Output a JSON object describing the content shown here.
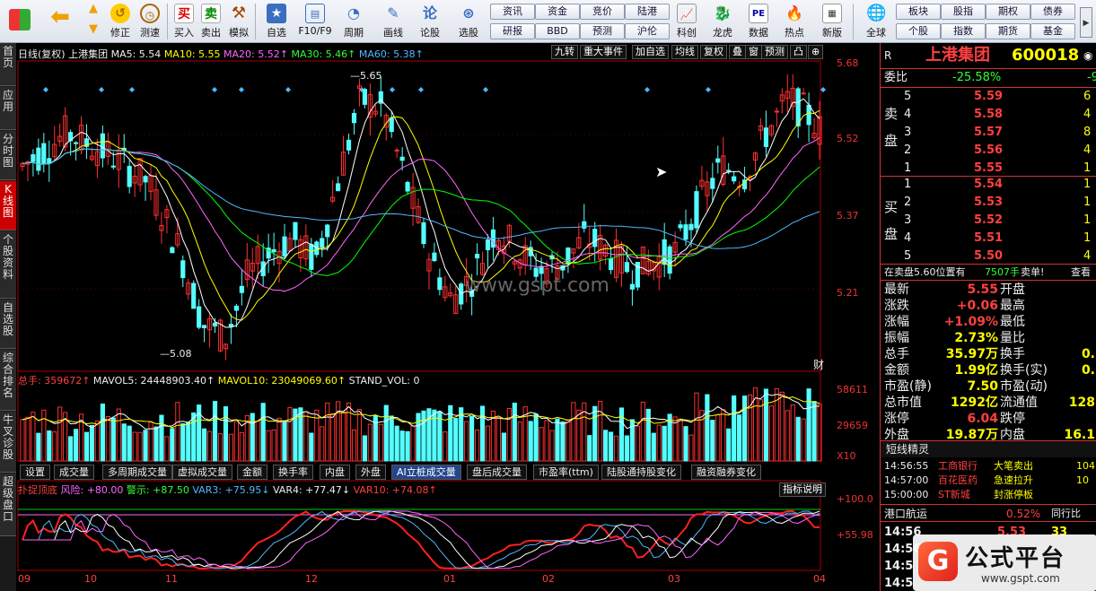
{
  "toolbar": {
    "big": [
      {
        "label": "",
        "icon": "windows-icon"
      },
      {
        "label": "",
        "icon": "back-arrow-icon"
      },
      {
        "label": "修正",
        "icon": "fix-icon"
      },
      {
        "label": "测速",
        "icon": "clock-icon"
      },
      {
        "label": "买入",
        "icon": "buy-icon",
        "glyph": "买"
      },
      {
        "label": "卖出",
        "icon": "sell-icon",
        "glyph": "卖"
      },
      {
        "label": "模拟",
        "icon": "hammer-icon"
      },
      {
        "label": "自选",
        "icon": "star-icon"
      },
      {
        "label": "F10/F9",
        "icon": "f10-icon"
      },
      {
        "label": "周期",
        "icon": "period-icon"
      },
      {
        "label": "画线",
        "icon": "pencil-icon"
      },
      {
        "label": "论股",
        "icon": "forum-icon",
        "glyph": "论"
      },
      {
        "label": "选股",
        "icon": "select-icon"
      },
      {
        "label": "科创",
        "icon": "kechuang-icon"
      },
      {
        "label": "龙虎",
        "icon": "dragon-icon"
      },
      {
        "label": "数据",
        "icon": "data-icon",
        "glyph": "PE"
      },
      {
        "label": "热点",
        "icon": "hot-icon"
      },
      {
        "label": "新版",
        "icon": "newver-icon"
      },
      {
        "label": "全球",
        "icon": "globe-icon"
      }
    ],
    "small": [
      "资讯",
      "资金",
      "竞价",
      "陆港",
      "研报",
      "BBD",
      "预测",
      "沪伦",
      "板块",
      "股指",
      "期权",
      "债券",
      "个股",
      "指数",
      "期货",
      "基金"
    ]
  },
  "left_tabs": [
    "首页",
    "应用",
    "分时图",
    "K线图",
    "个股资料",
    "自选股",
    "综合排名",
    "牛叉诊股",
    "超级盘口"
  ],
  "chart": {
    "header": {
      "kline_label": "日线(复权)",
      "stock_name": "上港集团",
      "ma5": "MA5: 5.54",
      "ma10": "MA10: 5.55",
      "ma20": "MA20: 5.52↑",
      "ma30": "MA30: 5.46↑",
      "ma60": "MA60: 5.38↑"
    },
    "top_tools": [
      "九转",
      "重大事件",
      "加自选",
      "均线",
      "复权",
      "叠",
      "窗",
      "预测",
      "凸",
      "⊕"
    ],
    "price_axis": [
      "5.68",
      "5.52",
      "5.37",
      "5.21"
    ],
    "hi_label": "5.65",
    "lo_label": "5.08",
    "cai": "财",
    "watermark": "www.gspt.com",
    "vol_header": {
      "total": "总手: 359672↑",
      "mavol5": "MAVOL5: 24448903.40↑",
      "mavol10": "MAVOL10: 23049069.60↑",
      "stand": "STAND_VOL: 0"
    },
    "vol_axis": [
      "58611",
      "29659",
      "X10"
    ],
    "bottom_tabs": [
      "设置",
      "成交量",
      "多周期成交量",
      "虚拟成交量",
      "金额",
      "换手率",
      "内盘",
      "外盘",
      "AI立桩成交量",
      "盘后成交量",
      "市盈率(ttm)",
      "陆股通持股变化",
      "融资融券变化"
    ],
    "active_bottom_tab": "AI立桩成交量",
    "ind_header": {
      "name": "扑捉顶底",
      "risk": "风险: +80.00",
      "alert": "警示: +87.50",
      "var3": "VAR3: +75.95↓",
      "var4": "VAR4: +77.47↓",
      "var10": "VAR10: +74.08↑"
    },
    "ind_btn": "指标说明",
    "ind_axis": [
      "+100.0",
      "+55.98"
    ],
    "months": [
      "09",
      "10",
      "11",
      "12",
      "01",
      "02",
      "03",
      "04"
    ]
  },
  "chart_data": {
    "type": "candlestick",
    "note_ranges": "price axis 5.21–5.68",
    "ylim": [
      5.05,
      5.7
    ],
    "ma_colors": {
      "ma5": "#ffffff",
      "ma10": "#ffff00",
      "ma20": "#ff66ff",
      "ma30": "#00ff00",
      "ma60": "#4fb8ff"
    }
  },
  "right": {
    "code_r": "R",
    "name": "上港集团",
    "code": "600018",
    "weibi_label": "委比",
    "weibi": "-25.58%",
    "weibi_right": "-9",
    "sell_label": [
      "卖",
      "盘"
    ],
    "buy_label": [
      "买",
      "盘"
    ],
    "asks": [
      {
        "lv": "5",
        "price": "5.59",
        "vol": "6"
      },
      {
        "lv": "4",
        "price": "5.58",
        "vol": "4"
      },
      {
        "lv": "3",
        "price": "5.57",
        "vol": "8"
      },
      {
        "lv": "2",
        "price": "5.56",
        "vol": "4"
      },
      {
        "lv": "1",
        "price": "5.55",
        "vol": "1"
      }
    ],
    "bids": [
      {
        "lv": "1",
        "price": "5.54",
        "vol": "1"
      },
      {
        "lv": "2",
        "price": "5.53",
        "vol": "1"
      },
      {
        "lv": "3",
        "price": "5.52",
        "vol": "1"
      },
      {
        "lv": "4",
        "price": "5.51",
        "vol": "1"
      },
      {
        "lv": "5",
        "price": "5.50",
        "vol": "4"
      }
    ],
    "notice": "在卖盘5.60位置有",
    "notice_vol": "7507手",
    "notice_tag": "卖单!",
    "notice_btn": "查看",
    "stats": [
      {
        "l": "最新",
        "v": "5.55",
        "l2": "开盘",
        "v2": ""
      },
      {
        "l": "涨跌",
        "v": "+0.06",
        "l2": "最高",
        "v2": ""
      },
      {
        "l": "涨幅",
        "v": "+1.09%",
        "l2": "最低",
        "v2": ""
      },
      {
        "l": "振幅",
        "v": "2.73%",
        "l2": "量比",
        "v2": ""
      },
      {
        "l": "总手",
        "v": "35.97万",
        "l2": "换手",
        "v2": "0."
      },
      {
        "l": "金额",
        "v": "1.99亿",
        "l2": "换手(实)",
        "v2": "0."
      },
      {
        "l": "市盈(静)",
        "v": "7.50",
        "l2": "市盈(动)",
        "v2": ""
      },
      {
        "l": "总市值",
        "v": "1292亿",
        "l2": "流通值",
        "v2": "128"
      },
      {
        "l": "涨停",
        "v": "6.04",
        "l2": "跌停",
        "v2": ""
      },
      {
        "l": "外盘",
        "v": "19.87万",
        "l2": "内盘",
        "v2": "16.1"
      }
    ],
    "jingling_title": "短线精灵",
    "jingling": [
      {
        "t": "14:56:55",
        "n": "工商银行",
        "e": "大笔卖出",
        "v": "104"
      },
      {
        "t": "14:57:00",
        "n": "百花医药",
        "e": "急速拉升",
        "v": "10"
      },
      {
        "t": "15:00:00",
        "n": "ST新城",
        "e": "封涨停板",
        "v": ""
      }
    ],
    "industry": "港口航运",
    "industry_pct": "0.52%",
    "industry_more": "同行比",
    "ticks": [
      {
        "t": "14:56",
        "p": "5.53",
        "v": "33"
      },
      {
        "t": "14:56",
        "p": "",
        "v": ""
      },
      {
        "t": "14:5",
        "p": "",
        "v": ""
      },
      {
        "t": "14:5",
        "p": "",
        "v": ""
      }
    ],
    "logo_text": "公式平台",
    "logo_url": "www.gspt.com"
  }
}
